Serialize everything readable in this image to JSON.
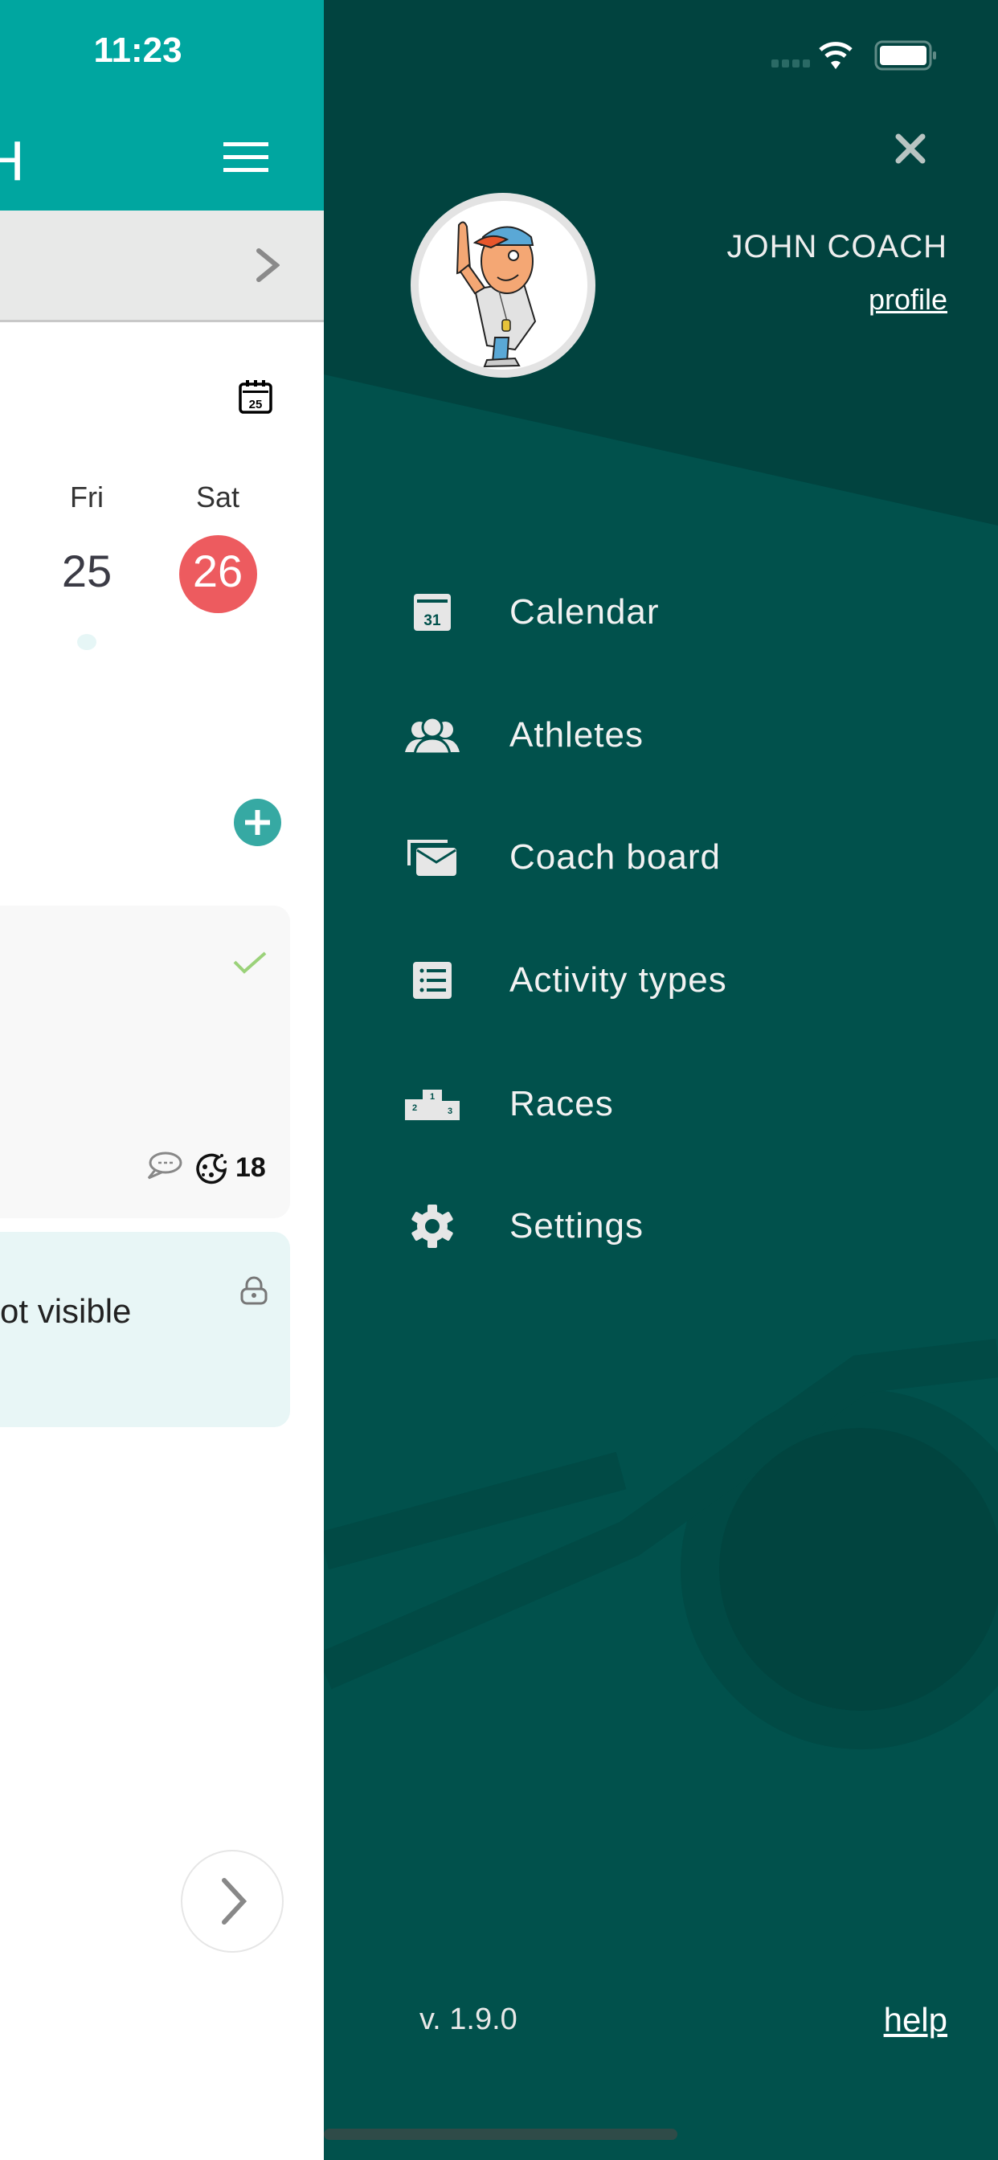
{
  "status_bar": {
    "time": "11:23"
  },
  "header": {
    "title_fragment": "H"
  },
  "week": {
    "days": [
      {
        "name": "Fri",
        "number": "25"
      },
      {
        "name": "Sat",
        "number": "26",
        "selected": true
      }
    ],
    "calendar_icon_day": "25"
  },
  "cards": [
    {
      "status": "check-icon",
      "comments_icon": "chat-icon",
      "stat_icon": "cookie-icon",
      "stat_value": "18"
    },
    {
      "text": "ot visible",
      "icon": "lock-icon"
    }
  ],
  "drawer": {
    "user_name": "JOHN COACH",
    "profile_link": "profile",
    "menu": [
      {
        "label": "Calendar",
        "icon": "calendar-icon",
        "icon_text": "31"
      },
      {
        "label": "Athletes",
        "icon": "people-icon"
      },
      {
        "label": "Coach board",
        "icon": "mail-icon"
      },
      {
        "label": "Activity types",
        "icon": "list-icon"
      },
      {
        "label": "Races",
        "icon": "podium-icon"
      },
      {
        "label": "Settings",
        "icon": "gear-icon"
      }
    ],
    "version": "v. 1.9.0",
    "help_link": "help"
  },
  "colors": {
    "header": "#00a6a0",
    "drawer": "#01514c",
    "drawer_top": "#01433f",
    "selected_day": "#ed5b5f",
    "accent": "#36a9a3"
  }
}
